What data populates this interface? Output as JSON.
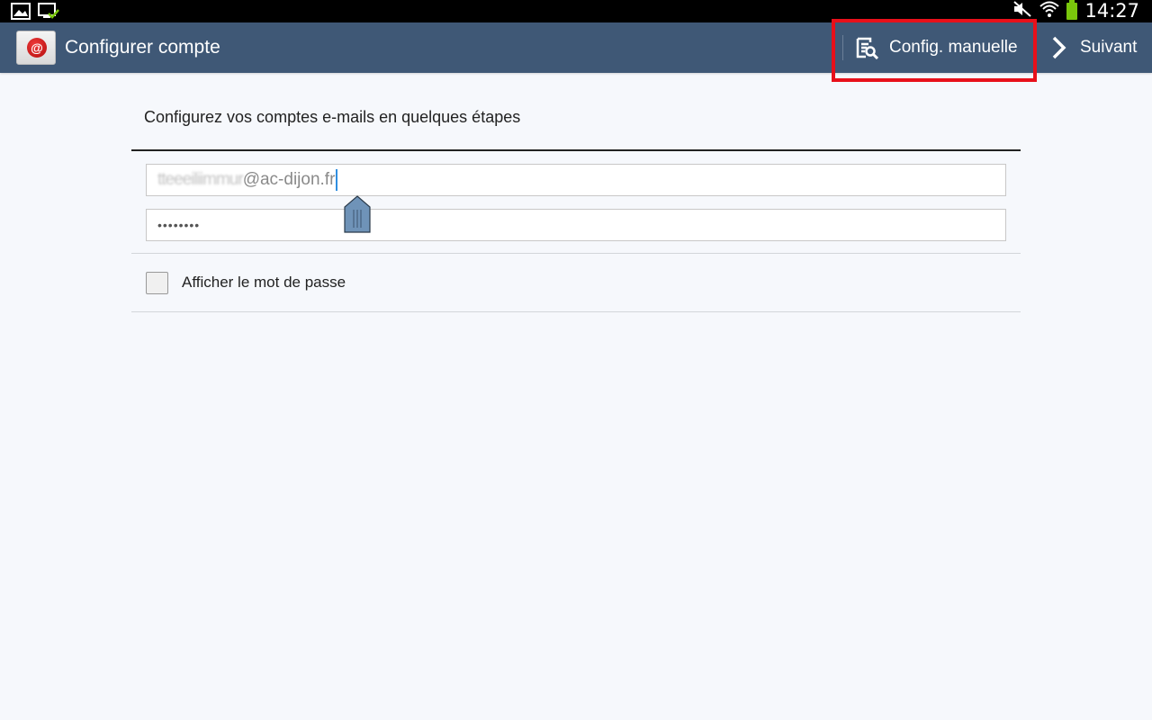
{
  "status_bar": {
    "time": "14:27",
    "left_icons": [
      "gallery-icon",
      "cast-check-icon"
    ],
    "right_icons": [
      "mute-icon",
      "wifi-icon",
      "battery-icon"
    ],
    "battery_color": "#7ac70c"
  },
  "action_bar": {
    "title": "Configurer compte",
    "manual_label": "Config. manuelle",
    "next_label": "Suivant",
    "app_icon_glyph": "@",
    "background": "#3f5876",
    "highlight_color": "#e8101a"
  },
  "form": {
    "heading": "Configurez vos comptes e-mails en quelques étapes",
    "email_blurred": "tteeeiliimmur",
    "email_domain": "@ac-dijon.fr",
    "password_masked": "••••••••",
    "show_password_label": "Afficher le mot de passe",
    "show_password_checked": false
  }
}
